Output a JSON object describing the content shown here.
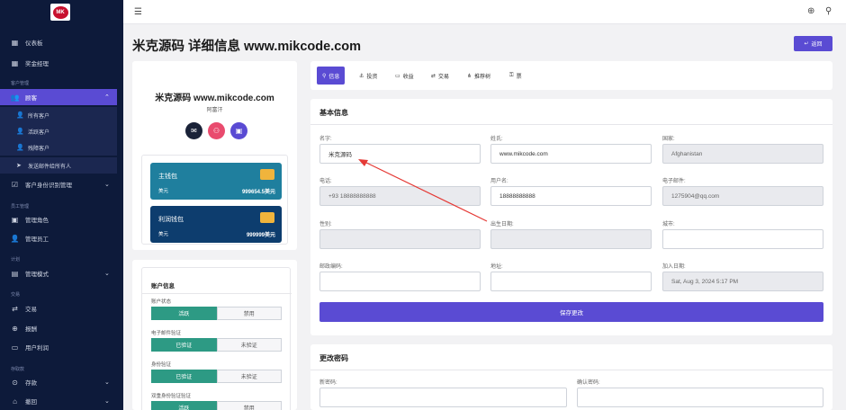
{
  "app": {
    "logo_text": "MK"
  },
  "sidebar": {
    "items": [
      {
        "label": "仪表板",
        "icon": "grid-icon"
      },
      {
        "label": "奖金经理",
        "icon": "grid-icon"
      }
    ],
    "section_customers": "客户管理",
    "customers_label": "顾客",
    "customers_sub": [
      {
        "label": "所有客户",
        "icon": "users-icon"
      },
      {
        "label": "活跃客户",
        "icon": "user-check-icon"
      },
      {
        "label": "残障客户",
        "icon": "user-x-icon"
      },
      {
        "label": "发送邮件给所有人",
        "icon": "send-icon"
      }
    ],
    "kyc_label": "客户身份识别管理",
    "section_staff": "员工管理",
    "staff_items": [
      {
        "label": "管理角色",
        "icon": "role-icon"
      },
      {
        "label": "管理员工",
        "icon": "staff-icon"
      }
    ],
    "section_plan": "计划",
    "plan_label": "管理模式",
    "section_trade": "交易",
    "trade_items": [
      {
        "label": "交易",
        "icon": "transaction-icon"
      },
      {
        "label": "报酬",
        "icon": "reward-icon"
      },
      {
        "label": "用户利润",
        "icon": "profit-icon"
      }
    ],
    "section_fund": "存取款",
    "fund_items": [
      {
        "label": "存款",
        "icon": "deposit-icon"
      },
      {
        "label": "撤回",
        "icon": "withdraw-icon"
      }
    ]
  },
  "header": {
    "title": "米克源码 详细信息 www.mikcode.com",
    "return_label": "返回"
  },
  "profile": {
    "name": "米克源码 www.mikcode.com",
    "country": "阿富汗",
    "wallets": [
      {
        "name": "主钱包",
        "currency": "美元",
        "balance": "999654.5美元",
        "color": "#1f7f9e"
      },
      {
        "name": "利润钱包",
        "currency": "美元",
        "balance": "999999美元",
        "color": "#0d3d6e"
      }
    ]
  },
  "account": {
    "title": "账户信息",
    "rows": [
      {
        "label": "账户状态",
        "options": [
          "活跃",
          "禁用"
        ],
        "selected": 0
      },
      {
        "label": "电子邮件验证",
        "options": [
          "已验证",
          "未验证"
        ],
        "selected": 0
      },
      {
        "label": "身份验证",
        "options": [
          "已验证",
          "未验证"
        ],
        "selected": 0
      },
      {
        "label": "双重身份验证验证",
        "options": [
          "活跃",
          "禁用"
        ],
        "selected": 0
      }
    ]
  },
  "tabs": [
    {
      "label": "信息",
      "icon": "user-icon",
      "active": true
    },
    {
      "label": "投资",
      "icon": "anchor-icon",
      "active": false
    },
    {
      "label": "收益",
      "icon": "wallet-icon",
      "active": false
    },
    {
      "label": "交易",
      "icon": "transaction-icon",
      "active": false
    },
    {
      "label": "推荐树",
      "icon": "tree-icon",
      "active": false
    },
    {
      "label": "票",
      "icon": "ticket-icon",
      "active": false
    }
  ],
  "basic_info": {
    "title": "基本信息",
    "fields": {
      "first_name": {
        "label": "名字:",
        "value": "米克源码"
      },
      "last_name": {
        "label": "姓氏:",
        "value": "www.mikcode.com"
      },
      "country": {
        "label": "国家:",
        "value": "Afghanistan"
      },
      "phone": {
        "label": "电话:",
        "value": "+93 18888888888"
      },
      "username": {
        "label": "用户名:",
        "value": "18888888888"
      },
      "email": {
        "label": "电子邮件:",
        "value": "1275904@qq.com"
      },
      "gender": {
        "label": "性别:",
        "value": ""
      },
      "birthday": {
        "label": "出生日期:",
        "value": ""
      },
      "city": {
        "label": "城市:",
        "value": ""
      },
      "postal": {
        "label": "邮政编码:",
        "value": ""
      },
      "address": {
        "label": "地址:",
        "value": ""
      },
      "joined": {
        "label": "加入日期:",
        "value": "Sat, Aug 3, 2024 5:17 PM"
      }
    },
    "save_label": "保存更改"
  },
  "password": {
    "title": "更改密码",
    "new_label": "新密码:",
    "confirm_label": "确认密码:"
  },
  "colors": {
    "accent": "#5a4bd3",
    "sidebar": "#0d1a3a",
    "success": "#2d9a84",
    "annotation": "#e53935"
  }
}
